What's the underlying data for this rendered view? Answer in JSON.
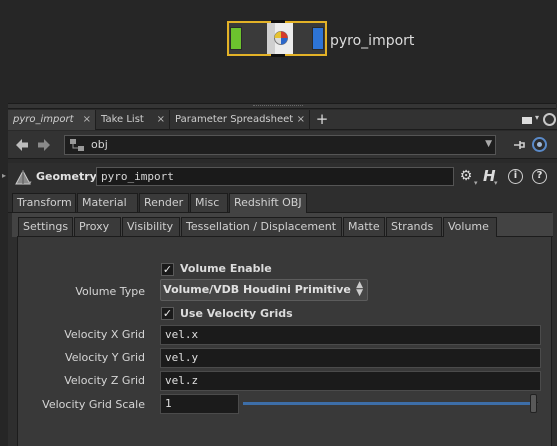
{
  "network": {
    "node_label": "pyro_import"
  },
  "pane_tabs": [
    {
      "label": "pyro_import"
    },
    {
      "label": "Take List"
    },
    {
      "label": "Parameter Spreadsheet"
    }
  ],
  "path": {
    "value": "obj"
  },
  "header": {
    "type_label": "Geometry",
    "node_name": "pyro_import"
  },
  "tabs_top": [
    "Transform",
    "Material",
    "Render",
    "Misc",
    "Redshift OBJ"
  ],
  "tabs_sub": [
    "Settings",
    "Proxy",
    "Visibility",
    "Tessellation / Displacement",
    "Matte",
    "Strands",
    "Volume"
  ],
  "params": {
    "volume_enable": {
      "label": "Volume Enable",
      "checked": true
    },
    "volume_type": {
      "label": "Volume Type",
      "value": "Volume/VDB Houdini Primitive"
    },
    "use_velocity_grids": {
      "label": "Use Velocity Grids",
      "checked": true
    },
    "velocity_x": {
      "label": "Velocity X Grid",
      "value": "vel.x"
    },
    "velocity_y": {
      "label": "Velocity Y Grid",
      "value": "vel.y"
    },
    "velocity_z": {
      "label": "Velocity Z Grid",
      "value": "vel.z"
    },
    "velocity_scale": {
      "label": "Velocity Grid Scale",
      "value": "1",
      "slider_fraction": 1.0
    }
  },
  "colors": {
    "node_border": "#e3b227",
    "node_left": "#6cc22e",
    "node_right": "#2d74d6",
    "slider_fill": "#3d6ea8"
  },
  "icons": [
    "back-arrow-icon",
    "forward-arrow-icon",
    "network-path-icon",
    "pin-icon",
    "gear-icon",
    "houdini-help-icon",
    "info-icon",
    "help-icon",
    "plus-icon",
    "close-icon"
  ]
}
